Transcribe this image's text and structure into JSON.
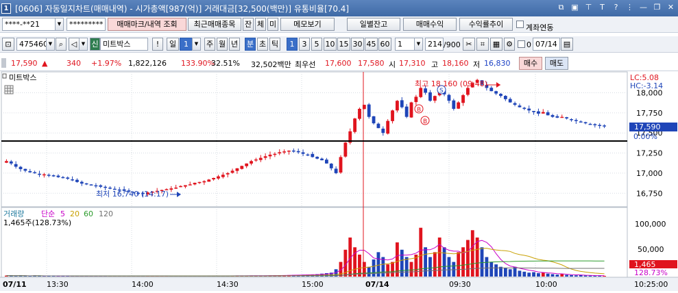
{
  "window": {
    "number": "1",
    "title": "[0606] 자동일지차트(매매내역) - 시가총액[987(억)] 거래대금[32,500(백만)] 유통비율[70.4]"
  },
  "toolbar1": {
    "account": "****-**21",
    "password": "*********",
    "btn_trade_mark": "매매마크/내역 조회",
    "btn_recent": "최근매매종목",
    "btn_jan": "잔",
    "btn_che": "체",
    "btn_mi": "미",
    "btn_memo": "메모보기",
    "btn_daily": "일별잔고",
    "btn_profit": "매매수익",
    "btn_yield": "수익률추이",
    "chk_link": "계좌연동"
  },
  "toolbar2": {
    "code": "475460",
    "market_badge": "신",
    "stock_name": "미트박스",
    "exclaim": "!",
    "period_label": "일",
    "period_value": "1",
    "periods": [
      "주",
      "월",
      "년",
      "분",
      "초",
      "틱"
    ],
    "active_period": "분",
    "intervals": [
      "1",
      "3",
      "5",
      "10",
      "15",
      "30",
      "45",
      "60"
    ],
    "active_interval": "1",
    "count_value": "1",
    "bars": "214",
    "bars_total": "/900",
    "date_chk": "0",
    "date_value": "07/14"
  },
  "quote": {
    "price": "17,590",
    "arrow": "▲",
    "change": "340",
    "change_pct": "+1.97%",
    "volume": "1,822,126",
    "vol_ratio": "133.90%",
    "turnover": "32.51%",
    "amount": "32,502백만",
    "best_label": "최우선",
    "ask": "17,600",
    "bid": "17,580",
    "open_label": "시",
    "open": "17,310",
    "high_label": "고",
    "high": "18,160",
    "low_label": "저",
    "low": "16,830",
    "buy_label": "매수",
    "sell_label": "매도"
  },
  "price_panel": {
    "legend": "미트박스",
    "lc": "LC:5.08",
    "hc": "HC:-3.14",
    "high_annot": "최고 18,160 (09:48)",
    "low_annot": "최저 16,740 (14:17)",
    "current_price_tag": "17,590",
    "zero_tag": "0.00%",
    "y_ticks": [
      "18,000",
      "17,750",
      "17,500",
      "17,250",
      "17,000",
      "16,750"
    ]
  },
  "volume_panel": {
    "legend_title": "거래량",
    "legend_ma": "단순",
    "ma_periods": [
      "5",
      "20",
      "60",
      "120"
    ],
    "sub": "1,465주(128.73%)",
    "value_tag": "1,465",
    "pct_tag": "128.73%",
    "y_ticks": [
      "100,000",
      "50,000"
    ]
  },
  "time_axis": {
    "labels": [
      "07/11",
      "13:30",
      "14:00",
      "14:30",
      "15:00",
      "07/14",
      "09:30",
      "10:00"
    ],
    "clock": "10:25:00"
  },
  "colors": {
    "up": "#e0141e",
    "down": "#1f45b8",
    "ma5": "#c800c8",
    "ma20": "#c8a000",
    "ma60": "#2a9a2a",
    "ma120": "#707070",
    "divider": "#e0141e"
  },
  "chart_data": {
    "type": "candlestick",
    "ylim": [
      16650,
      18200
    ],
    "series_desc": "Minute candles, price path",
    "price_path": [
      17150,
      17120,
      17080,
      17050,
      17030,
      17010,
      17000,
      16990,
      16985,
      16970,
      16960,
      16950,
      16940,
      16930,
      16910,
      16890,
      16870,
      16860,
      16850,
      16840,
      16830,
      16820,
      16810,
      16800,
      16790,
      16780,
      16770,
      16760,
      16750,
      16745,
      16760,
      16770,
      16780,
      16790,
      16800,
      16810,
      16820,
      16840,
      16850,
      16860,
      16880,
      16890,
      16900,
      16920,
      16940,
      16960,
      16980,
      17000,
      17030,
      17060,
      17090,
      17120,
      17150,
      17170,
      17190,
      17210,
      17230,
      17240,
      17260,
      17270,
      17280,
      17270,
      17260,
      17240,
      17230,
      17200,
      17180,
      17160,
      17120,
      17060,
      17000,
      17200,
      17380,
      17520,
      17680,
      17800,
      17850,
      17700,
      17620,
      17560,
      17500,
      17650,
      17780,
      17900,
      17820,
      17700,
      17880,
      17950,
      18060,
      18000,
      17900,
      17960,
      18050,
      17980,
      17900,
      17800,
      17880,
      17970,
      18060,
      18120,
      18160,
      18100,
      18060,
      18020,
      17990,
      17960,
      17920,
      17880,
      17850,
      17820,
      17800,
      17780,
      17760,
      17740,
      17760,
      17720,
      17700,
      17690,
      17700,
      17680,
      17660,
      17650,
      17640,
      17620,
      17610,
      17600,
      17590,
      17590
    ],
    "volume_path": [
      2000,
      1500,
      1200,
      1800,
      1300,
      1000,
      2200,
      900,
      1100,
      1600,
      1200,
      800,
      1400,
      1000,
      900,
      1100,
      1300,
      900,
      1200,
      1500,
      900,
      700,
      1000,
      1400,
      900,
      800,
      1100,
      1600,
      1200,
      900,
      1000,
      1100,
      900,
      1200,
      1300,
      800,
      1100,
      900,
      1000,
      1200,
      1500,
      1100,
      900,
      1400,
      1600,
      1300,
      1100,
      1200,
      1800,
      2000,
      1600,
      1400,
      1900,
      2100,
      1800,
      1700,
      2000,
      2300,
      2500,
      2800,
      3000,
      3200,
      3500,
      3800,
      4200,
      4000,
      5000,
      6000,
      7000,
      8000,
      15000,
      30000,
      55000,
      80000,
      60000,
      45000,
      30000,
      20000,
      35000,
      50000,
      40000,
      25000,
      30000,
      70000,
      55000,
      40000,
      30000,
      45000,
      100000,
      60000,
      40000,
      50000,
      80000,
      60000,
      40000,
      30000,
      50000,
      60000,
      75000,
      95000,
      80000,
      60000,
      40000,
      30000,
      25000,
      20000,
      18000,
      15000,
      20000,
      12000,
      10000,
      8000,
      9000,
      7000,
      8000,
      6000,
      5000,
      4000,
      5000,
      3500,
      3000,
      2500,
      3000,
      2000,
      1800,
      1500,
      1465,
      1465
    ]
  }
}
